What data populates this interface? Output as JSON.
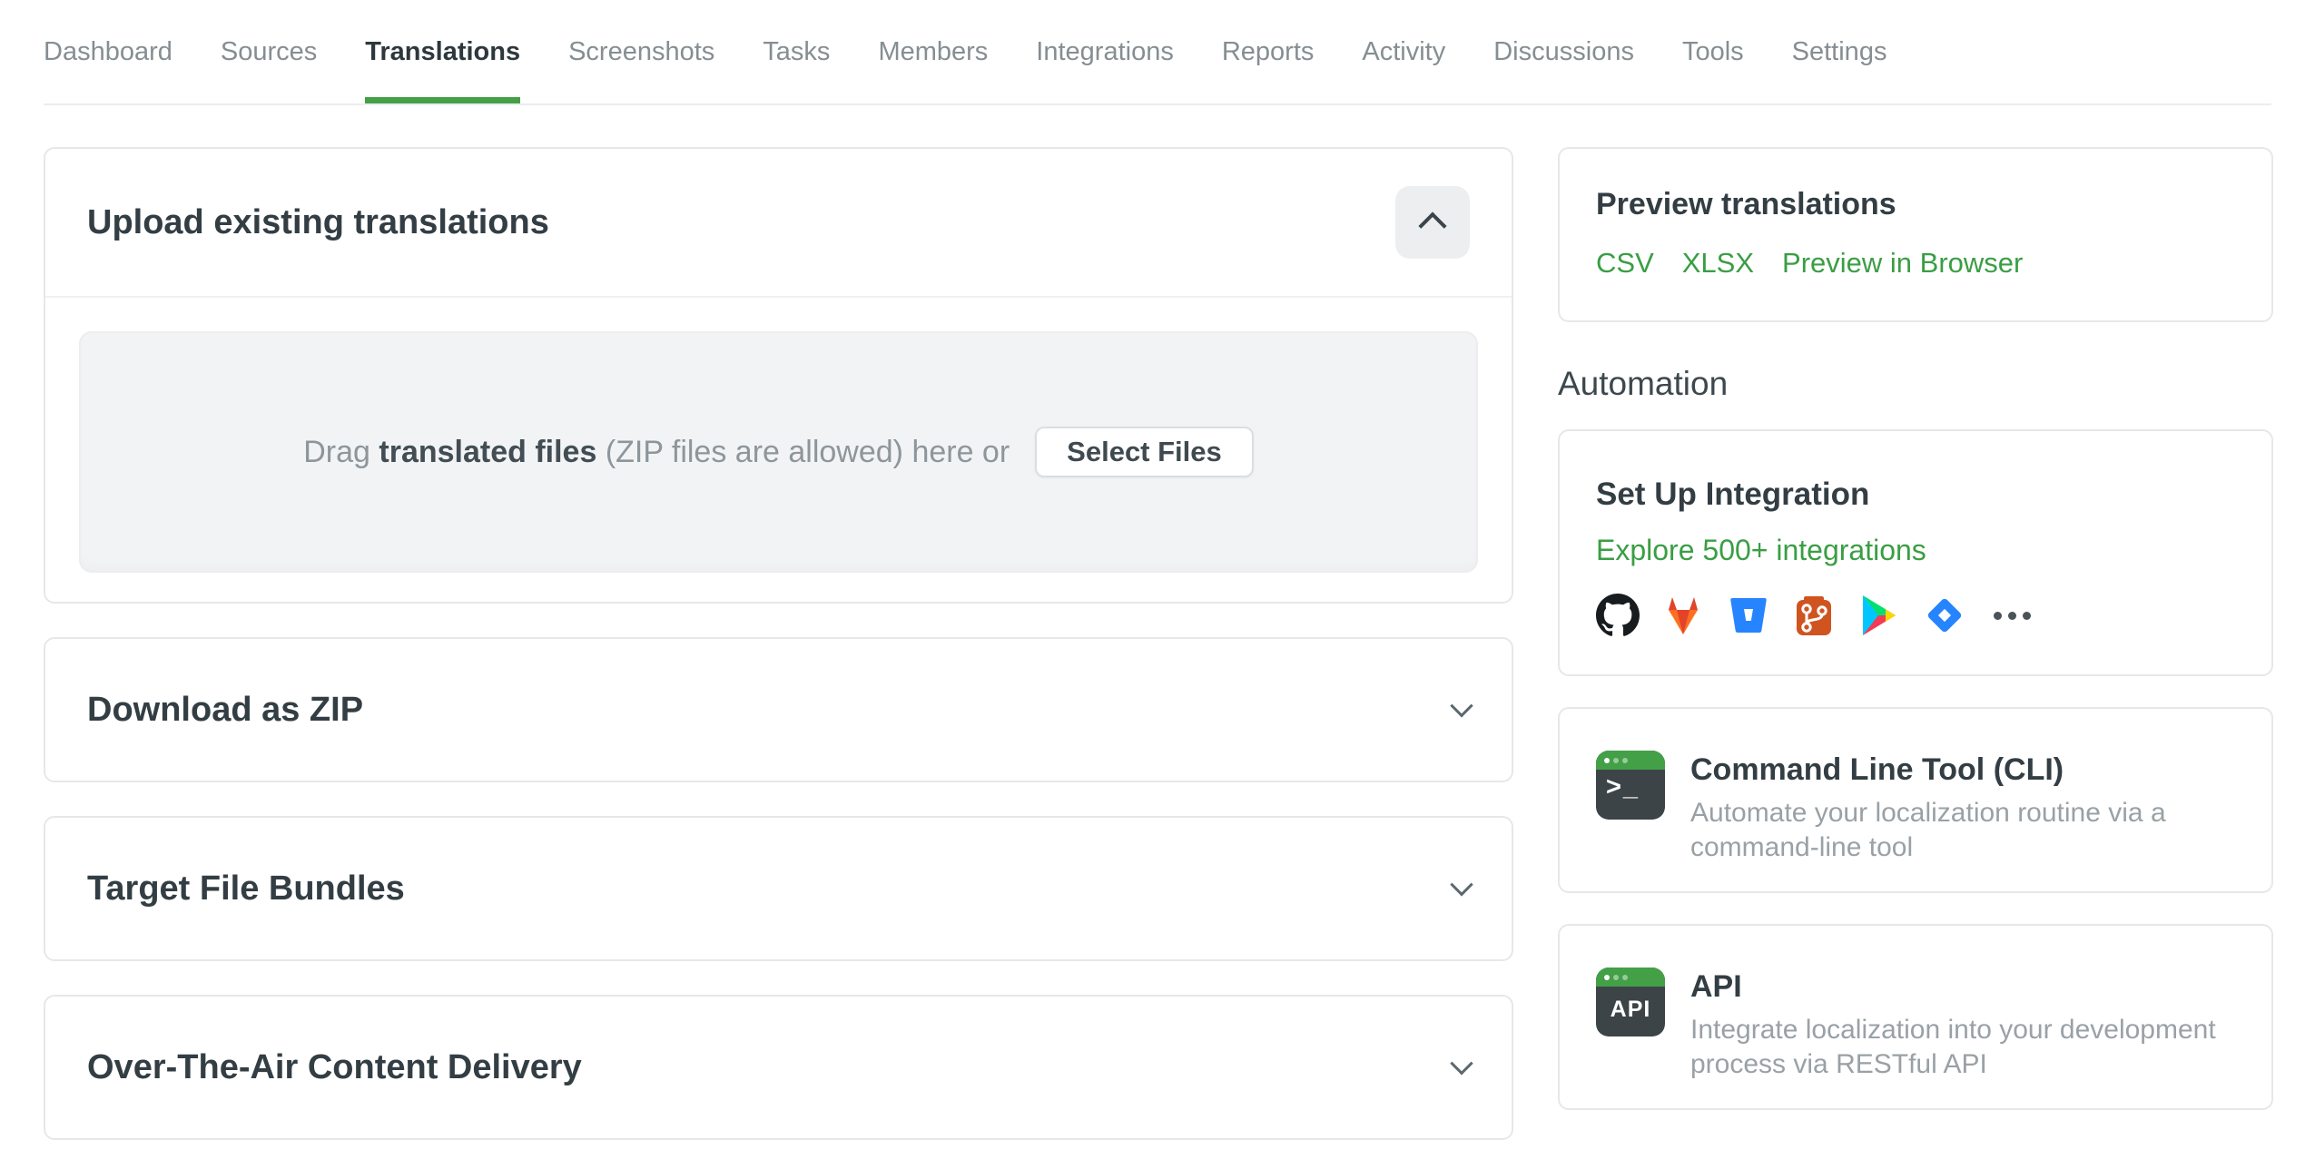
{
  "nav": {
    "tabs": [
      {
        "label": "Dashboard",
        "active": false
      },
      {
        "label": "Sources",
        "active": false
      },
      {
        "label": "Translations",
        "active": true
      },
      {
        "label": "Screenshots",
        "active": false
      },
      {
        "label": "Tasks",
        "active": false
      },
      {
        "label": "Members",
        "active": false
      },
      {
        "label": "Integrations",
        "active": false
      },
      {
        "label": "Reports",
        "active": false
      },
      {
        "label": "Activity",
        "active": false
      },
      {
        "label": "Discussions",
        "active": false
      },
      {
        "label": "Tools",
        "active": false
      },
      {
        "label": "Settings",
        "active": false
      }
    ]
  },
  "upload": {
    "title": "Upload existing translations",
    "collapse_icon": "chevron-up-icon",
    "dropzone": {
      "text_prefix": "Drag",
      "text_highlight": "translated files",
      "text_suffix": "(ZIP files are allowed) here or",
      "select_button": "Select Files"
    }
  },
  "collapsed_sections": [
    {
      "title": "Download as ZIP"
    },
    {
      "title": "Target File Bundles"
    },
    {
      "title": "Over-The-Air Content Delivery"
    }
  ],
  "sidebar": {
    "preview": {
      "title": "Preview translations",
      "links": [
        "CSV",
        "XLSX",
        "Preview in Browser"
      ]
    },
    "automation_heading": "Automation",
    "integration": {
      "title": "Set Up Integration",
      "link": "Explore 500+ integrations",
      "icons": [
        "github",
        "gitlab",
        "bitbucket",
        "git",
        "google-play",
        "jira",
        "more"
      ]
    },
    "tools": [
      {
        "icon": "terminal-cli",
        "icon_text": ">_",
        "title": "Command Line Tool (CLI)",
        "description": "Automate your localization routine via a command-line tool"
      },
      {
        "icon": "terminal-api",
        "icon_text": "API",
        "title": "API",
        "description": "Integrate localization into your development process via RESTful API"
      }
    ]
  },
  "colors": {
    "accent_green": "#43a047",
    "link_green": "#3a9e44",
    "heading_dark": "#333e44",
    "nav_inactive": "#858e92",
    "nav_active": "#2d383e",
    "muted_text": "#8d969b",
    "description_text": "#99a1a6"
  }
}
